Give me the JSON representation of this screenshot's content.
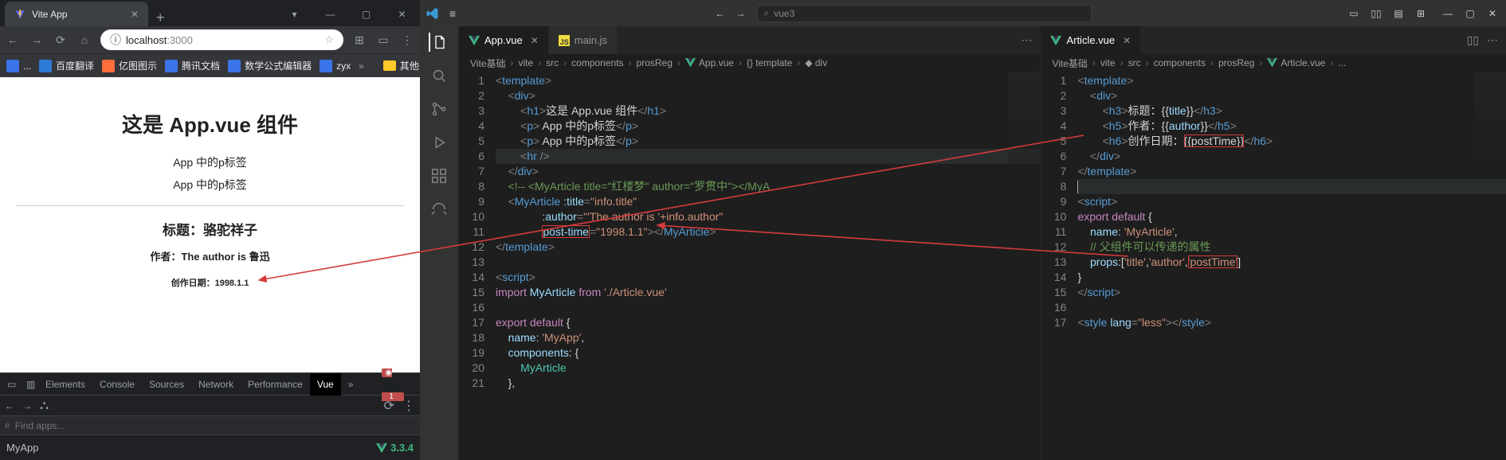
{
  "browser": {
    "tab": {
      "title": "Vite App"
    },
    "winctl": {
      "min": "—",
      "down": "▾",
      "max": "▢",
      "close": "✕"
    },
    "url": {
      "host": "localhost",
      "port": ":3000"
    },
    "toolbar_icons": {
      "back": "←",
      "fwd": "→",
      "reload": "⟳",
      "home": "⌂",
      "star": "☆",
      "puzzle": "⊞",
      "reader": "▭",
      "menu": "⋮"
    },
    "bookmarks": [
      {
        "color": "#3b73e8",
        "label": "..."
      },
      {
        "color": "#2e7bd6",
        "label": "百度翻译"
      },
      {
        "color": "#ff6f3c",
        "label": "亿图图示"
      },
      {
        "color": "#3b73e8",
        "label": "腾讯文档"
      },
      {
        "color": "#3b73e8",
        "label": "数学公式编辑器"
      },
      {
        "color": "#3b73e8",
        "label": "zyx"
      }
    ],
    "bookmarks_more": "»",
    "bookmarks_folder": "其他书签",
    "page": {
      "h1": "这是 App.vue 组件",
      "p1": "App 中的p标签",
      "p2": "App 中的p标签",
      "h3": "标题：骆驼祥子",
      "h5": "作者：The author is 鲁迅",
      "h6": "创作日期：1998.1.1"
    },
    "devtools": {
      "tabs": [
        "Elements",
        "Console",
        "Sources",
        "Network",
        "Performance",
        "Vue"
      ],
      "active": "Vue",
      "more": "»",
      "err_count": "1",
      "gear": "⚙",
      "dots": "⋮",
      "close": "✕",
      "search_icon": "⌕",
      "search_placeholder": "Find apps...",
      "app_name": "MyApp",
      "vue_version": "3.3.4"
    }
  },
  "vscode": {
    "title_menu": "≡",
    "nav": {
      "back": "←",
      "fwd": "→"
    },
    "search_text": "vue3",
    "search_icon": "⌕",
    "layout_icons": [
      "▭",
      "▯▯",
      "▤",
      "⊞"
    ],
    "winctl": {
      "min": "—",
      "max": "▢",
      "close": "✕"
    },
    "activity": [
      "files",
      "search",
      "scm",
      "debug",
      "extensions",
      "remote"
    ],
    "editorA": {
      "tabs": [
        {
          "name": "App.vue",
          "kind": "vue",
          "active": true,
          "show_close": true
        },
        {
          "name": "main.js",
          "kind": "js",
          "active": false,
          "show_close": false
        }
      ],
      "trail": "⋯",
      "breadcrumb": [
        "Vite基础",
        "vite",
        "src",
        "components",
        "prosReg",
        "App.vue",
        "{} template",
        "◆ div"
      ],
      "lines": [
        [
          [
            "t",
            "<"
          ],
          [
            "tn",
            "template"
          ],
          [
            "t",
            ">"
          ]
        ],
        [
          [
            "sp",
            "    "
          ],
          [
            "t",
            "<"
          ],
          [
            "tn",
            "div"
          ],
          [
            "t",
            ">"
          ]
        ],
        [
          [
            "sp",
            "        "
          ],
          [
            "t",
            "<"
          ],
          [
            "tn",
            "h1"
          ],
          [
            "t",
            ">"
          ],
          [
            "punc",
            "这是 App.vue 组件"
          ],
          [
            "t",
            "</"
          ],
          [
            "tn",
            "h1"
          ],
          [
            "t",
            ">"
          ]
        ],
        [
          [
            "sp",
            "        "
          ],
          [
            "t",
            "<"
          ],
          [
            "tn",
            "p"
          ],
          [
            "t",
            "> "
          ],
          [
            "punc",
            "App 中的p标签"
          ],
          [
            "t",
            "</"
          ],
          [
            "tn",
            "p"
          ],
          [
            "t",
            ">"
          ]
        ],
        [
          [
            "sp",
            "        "
          ],
          [
            "t",
            "<"
          ],
          [
            "tn",
            "p"
          ],
          [
            "t",
            "> "
          ],
          [
            "punc",
            "App 中的p标签"
          ],
          [
            "t",
            "</"
          ],
          [
            "tn",
            "p"
          ],
          [
            "t",
            ">"
          ]
        ],
        [
          [
            "sp",
            "        "
          ],
          [
            "t",
            "<"
          ],
          [
            "tn",
            "hr"
          ],
          [
            "t",
            " />"
          ]
        ],
        [
          [
            "sp",
            "    "
          ],
          [
            "t",
            "</"
          ],
          [
            "tn",
            "div"
          ],
          [
            "t",
            ">"
          ]
        ],
        [
          [
            "sp",
            "    "
          ],
          [
            "cm",
            "<!-- <MyArticle title=\"红楼梦\" author=\"罗贯中\"></MyA"
          ]
        ],
        [
          [
            "sp",
            "    "
          ],
          [
            "t",
            "<"
          ],
          [
            "tn",
            "MyArticle"
          ],
          [
            "punc",
            " "
          ],
          [
            "an",
            ":title"
          ],
          [
            "t",
            "="
          ],
          [
            "s",
            "\"info.title\""
          ]
        ],
        [
          [
            "sp",
            "               "
          ],
          [
            "an",
            ":author"
          ],
          [
            "t",
            "="
          ],
          [
            "s",
            "\"'The author is '+info.author\""
          ]
        ],
        [
          [
            "sp",
            "               "
          ],
          [
            "an",
            "post-time"
          ],
          [
            "t",
            "="
          ],
          [
            "s",
            "\"1998.1.1\""
          ],
          [
            "t",
            "></"
          ],
          [
            "tn",
            "MyArticle"
          ],
          [
            "t",
            ">"
          ]
        ],
        [
          [
            "t",
            "</"
          ],
          [
            "tn",
            "template"
          ],
          [
            "t",
            ">"
          ]
        ],
        [],
        [
          [
            "t",
            "<"
          ],
          [
            "tn",
            "script"
          ],
          [
            "t",
            ">"
          ]
        ],
        [
          [
            "kw2",
            "import"
          ],
          [
            "punc",
            " "
          ],
          [
            "id",
            "MyArticle"
          ],
          [
            "punc",
            " "
          ],
          [
            "kw2",
            "from"
          ],
          [
            "punc",
            " "
          ],
          [
            "s",
            "'./Article.vue'"
          ]
        ],
        [],
        [
          [
            "kw2",
            "export"
          ],
          [
            "punc",
            " "
          ],
          [
            "kw2",
            "default"
          ],
          [
            "punc",
            " {"
          ]
        ],
        [
          [
            "sp",
            "    "
          ],
          [
            "id",
            "name"
          ],
          [
            "punc",
            ": "
          ],
          [
            "s",
            "'MyApp'"
          ],
          [
            "punc",
            ","
          ]
        ],
        [
          [
            "sp",
            "    "
          ],
          [
            "id",
            "components"
          ],
          [
            "punc",
            ": {"
          ]
        ],
        [
          [
            "sp",
            "        "
          ],
          [
            "cls",
            "MyArticle"
          ]
        ],
        [
          [
            "sp",
            "    "
          ],
          [
            "punc",
            "},"
          ]
        ]
      ],
      "highlight_line_11_attr": "post-time"
    },
    "editorB": {
      "tabs": [
        {
          "name": "Article.vue",
          "kind": "vue",
          "active": true,
          "show_close": true
        }
      ],
      "trail_icons": [
        "▯▯",
        "⋯"
      ],
      "breadcrumb": [
        "Vite基础",
        "vite",
        "src",
        "components",
        "prosReg",
        "Article.vue",
        "..."
      ],
      "lines": [
        [
          [
            "t",
            "<"
          ],
          [
            "tn",
            "template"
          ],
          [
            "t",
            ">"
          ]
        ],
        [
          [
            "sp",
            "    "
          ],
          [
            "t",
            "<"
          ],
          [
            "tn",
            "div"
          ],
          [
            "t",
            ">"
          ]
        ],
        [
          [
            "sp",
            "        "
          ],
          [
            "t",
            "<"
          ],
          [
            "tn",
            "h3"
          ],
          [
            "t",
            ">"
          ],
          [
            "punc",
            "标题："
          ],
          [
            "punc",
            "{{"
          ],
          [
            "id",
            "title"
          ],
          [
            "punc",
            "}}"
          ],
          [
            "t",
            "</"
          ],
          [
            "tn",
            "h3"
          ],
          [
            "t",
            ">"
          ]
        ],
        [
          [
            "sp",
            "        "
          ],
          [
            "t",
            "<"
          ],
          [
            "tn",
            "h5"
          ],
          [
            "t",
            ">"
          ],
          [
            "punc",
            "作者："
          ],
          [
            "punc",
            "{{"
          ],
          [
            "id",
            "author"
          ],
          [
            "punc",
            "}}"
          ],
          [
            "t",
            "</"
          ],
          [
            "tn",
            "h5"
          ],
          [
            "t",
            ">"
          ]
        ],
        [
          [
            "sp",
            "        "
          ],
          [
            "t",
            "<"
          ],
          [
            "tn",
            "h6"
          ],
          [
            "t",
            ">"
          ],
          [
            "punc",
            "创作日期："
          ],
          [
            "box",
            "{{postTime}}"
          ],
          [
            "t",
            "</"
          ],
          [
            "tn",
            "h6"
          ],
          [
            "t",
            ">"
          ]
        ],
        [
          [
            "sp",
            "    "
          ],
          [
            "t",
            "</"
          ],
          [
            "tn",
            "div"
          ],
          [
            "t",
            ">"
          ]
        ],
        [
          [
            "t",
            "</"
          ],
          [
            "tn",
            "template"
          ],
          [
            "t",
            ">"
          ]
        ],
        [
          [
            "cursor",
            ""
          ]
        ],
        [
          [
            "t",
            "<"
          ],
          [
            "tn",
            "script"
          ],
          [
            "t",
            ">"
          ]
        ],
        [
          [
            "kw2",
            "export"
          ],
          [
            "punc",
            " "
          ],
          [
            "kw2",
            "default"
          ],
          [
            "punc",
            " {"
          ]
        ],
        [
          [
            "sp",
            "    "
          ],
          [
            "id",
            "name"
          ],
          [
            "punc",
            ": "
          ],
          [
            "s",
            "'MyArticle'"
          ],
          [
            "punc",
            ","
          ]
        ],
        [
          [
            "sp",
            "    "
          ],
          [
            "cm",
            "// 父组件可以传递的属性"
          ]
        ],
        [
          [
            "sp",
            "    "
          ],
          [
            "id",
            "props"
          ],
          [
            "punc",
            ":["
          ],
          [
            "s",
            "'title'"
          ],
          [
            "punc",
            ","
          ],
          [
            "s",
            "'author'"
          ],
          [
            "punc",
            ","
          ],
          [
            "box2",
            "'postTime'"
          ],
          [
            "punc",
            "]"
          ]
        ],
        [
          [
            "punc",
            "}"
          ]
        ],
        [
          [
            "t",
            "</"
          ],
          [
            "tn",
            "script"
          ],
          [
            "t",
            ">"
          ]
        ],
        [],
        [
          [
            "t",
            "<"
          ],
          [
            "tn",
            "style"
          ],
          [
            "punc",
            " "
          ],
          [
            "an",
            "lang"
          ],
          [
            "t",
            "="
          ],
          [
            "s",
            "\"less\""
          ],
          [
            "t",
            "></"
          ],
          [
            "tn",
            "style"
          ],
          [
            "t",
            ">"
          ]
        ]
      ]
    }
  }
}
